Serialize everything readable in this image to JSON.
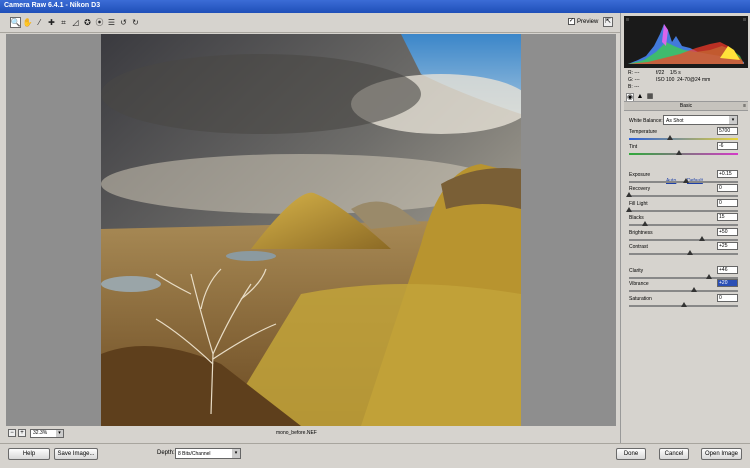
{
  "window": {
    "title": "Camera Raw 6.4.1  -  Nikon D3"
  },
  "toolbar": {
    "tools": [
      {
        "name": "zoom-tool",
        "glyph": "🔍"
      },
      {
        "name": "hand-tool",
        "glyph": "✋"
      },
      {
        "name": "white-balance-tool",
        "glyph": "⁄"
      },
      {
        "name": "color-sampler-tool",
        "glyph": "✚"
      },
      {
        "name": "crop-tool",
        "glyph": "⌗"
      },
      {
        "name": "straighten-tool",
        "glyph": "◿"
      },
      {
        "name": "spot-removal-tool",
        "glyph": "✪"
      },
      {
        "name": "red-eye-tool",
        "glyph": "⦿"
      },
      {
        "name": "preferences-tool",
        "glyph": "☰"
      },
      {
        "name": "rotate-left-tool",
        "glyph": "↺"
      },
      {
        "name": "rotate-right-tool",
        "glyph": "↻"
      }
    ],
    "preview_label": "Preview",
    "preview_checked": "✓"
  },
  "histogram_readout": {
    "r": "R:   ---",
    "g": "G:   ---",
    "b": "B:   ---",
    "aperture": "f/22",
    "shutter": "1/5 s",
    "iso": "ISO 100",
    "lens": "24-70@24 mm"
  },
  "panel": {
    "title": "Basic",
    "menu_icon": "≡",
    "tabs": [
      "◉",
      "▲",
      "▦"
    ],
    "white_balance_label": "White Balance:",
    "white_balance_value": "As Shot",
    "auto_label": "Auto",
    "default_label": "Default",
    "controls": [
      {
        "label": "Temperature",
        "value": "5700",
        "pos": 0.38,
        "track": "temp"
      },
      {
        "label": "Tint",
        "value": "-6",
        "pos": 0.46,
        "track": "tint"
      },
      {
        "label": "Exposure",
        "value": "+0.15",
        "pos": 0.52,
        "track": ""
      },
      {
        "label": "Recovery",
        "value": "0",
        "pos": 0.0,
        "track": ""
      },
      {
        "label": "Fill Light",
        "value": "0",
        "pos": 0.0,
        "track": ""
      },
      {
        "label": "Blacks",
        "value": "15",
        "pos": 0.15,
        "track": ""
      },
      {
        "label": "Brightness",
        "value": "+50",
        "pos": 0.67,
        "track": ""
      },
      {
        "label": "Contrast",
        "value": "+25",
        "pos": 0.56,
        "track": ""
      },
      {
        "label": "Clarity",
        "value": "+46",
        "pos": 0.73,
        "track": ""
      },
      {
        "label": "Vibrance",
        "value": "+20",
        "pos": 0.6,
        "track": "",
        "selected": true
      },
      {
        "label": "Saturation",
        "value": "0",
        "pos": 0.5,
        "track": ""
      }
    ]
  },
  "status": {
    "zoom_value": "32.3%",
    "filename": "mono_before.NEF"
  },
  "bottom": {
    "help": "Help",
    "save_image": "Save Image...",
    "depth_label": "Depth:",
    "depth_value": "8 Bits/Channel",
    "done": "Done",
    "cancel": "Cancel",
    "open_image": "Open Image"
  }
}
